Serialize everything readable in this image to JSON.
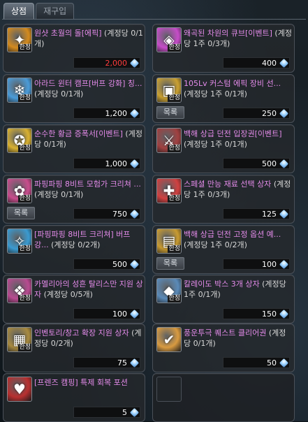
{
  "tabs": [
    "상점",
    "재구입"
  ],
  "items": [
    {
      "name": "원샷 초월의 돌[에픽]",
      "limit": "(계정당 0/1개)",
      "price": "2,000",
      "price_color": "red",
      "icon": "transcendence-stone-icon",
      "badge": "한정",
      "list_button": "",
      "icon_color": "#d38a1e"
    },
    {
      "name": "왜곡된 차원의 큐브[이벤트]",
      "limit": "(계정당 1주 0/3개)",
      "price": "400",
      "price_color": "white",
      "icon": "dimension-cube-icon",
      "badge": "한정",
      "list_button": "",
      "icon_color": "#c64cc8"
    },
    {
      "name": "아라드 윈터 캠프[버프 강화] 칭...",
      "limit": "(계정당 0/1개)",
      "price": "1,200",
      "price_color": "white",
      "icon": "winter-camp-icon",
      "badge": "한정",
      "list_button": "",
      "icon_color": "#4a9bd8"
    },
    {
      "name": "105Lv 커스텀 에픽 장비 선...",
      "limit": "(계정당 1주 0/1개)",
      "price": "250",
      "price_color": "white",
      "icon": "custom-epic-chest-icon",
      "badge": "한정",
      "list_button": "목록",
      "icon_color": "#caa030"
    },
    {
      "name": "순수한 황금 증폭서[이벤트]",
      "limit": "(계정당 0/1개)",
      "price": "1,000",
      "price_color": "white",
      "icon": "gold-amplify-scroll-icon",
      "badge": "한정",
      "list_button": "",
      "icon_color": "#d8b030"
    },
    {
      "name": "백해 상급 던전 입장권[이벤트]",
      "limit": "(계정당 1주 0/1개)",
      "price": "500",
      "price_color": "white",
      "icon": "dungeon-ticket-icon",
      "badge": "한정",
      "list_button": "",
      "icon_color": "#a04040"
    },
    {
      "name": "파핑파핑 8비트 모험가 크리쳐 ...",
      "limit": "(계정당 0/1개)",
      "price": "750",
      "price_color": "white",
      "icon": "8bit-creature-icon",
      "badge": "한정",
      "list_button": "목록",
      "icon_color": "#c84c8c"
    },
    {
      "name": "스페셜 만능 재료 선택 상자",
      "limit": "(계정당 1주 0/3개)",
      "price": "125",
      "price_color": "white",
      "icon": "material-box-icon",
      "badge": "한정",
      "list_button": "",
      "icon_color": "#d04040"
    },
    {
      "name": "[파핑파핑 8비트 크리쳐] 버프 강...",
      "limit": "(계정당 0/2개)",
      "price": "500",
      "price_color": "white",
      "icon": "creature-buff-icon",
      "badge": "한정",
      "list_button": "",
      "icon_color": "#3a9ad0"
    },
    {
      "name": "백해 상급 던전 고정 옵션 예...",
      "limit": "(계정당 1주 0/2개)",
      "price": "100",
      "price_color": "white",
      "icon": "fixed-option-chest-icon",
      "badge": "한정",
      "list_button": "목록",
      "icon_color": "#c89a30"
    },
    {
      "name": "카멜리아의 성흔 탈리스만 지원 상자",
      "limit": "(계정당 0/5개)",
      "price": "100",
      "price_color": "white",
      "icon": "talisman-box-icon",
      "badge": "한정",
      "list_button": "",
      "icon_color": "#b84a90"
    },
    {
      "name": "칼레이도 박스 3개 상자",
      "limit": "(계정당 1주 0/1개)",
      "price": "150",
      "price_color": "white",
      "icon": "kaleido-box-icon",
      "badge": "한정",
      "list_button": "",
      "icon_color": "#5a8ab8"
    },
    {
      "name": "인벤토리/창고 확장 지원 상자",
      "limit": "(계정당 0/2개)",
      "price": "75",
      "price_color": "white",
      "icon": "inventory-expand-box-icon",
      "badge": "한정",
      "list_button": "",
      "icon_color": "#a88a40"
    },
    {
      "name": "풍운투극 퀘스트 클리어권",
      "limit": "(계정당 0/1개)",
      "price": "50",
      "price_color": "white",
      "icon": "quest-clear-ticket-icon",
      "badge": "",
      "list_button": "",
      "icon_color": "#d89a40"
    },
    {
      "name": "[프렌즈 캠핑] 특제 회복 포션",
      "limit": "",
      "price": "5",
      "price_color": "white",
      "icon": "recovery-potion-icon",
      "badge": "",
      "list_button": "",
      "icon_color": "#b83030"
    }
  ]
}
